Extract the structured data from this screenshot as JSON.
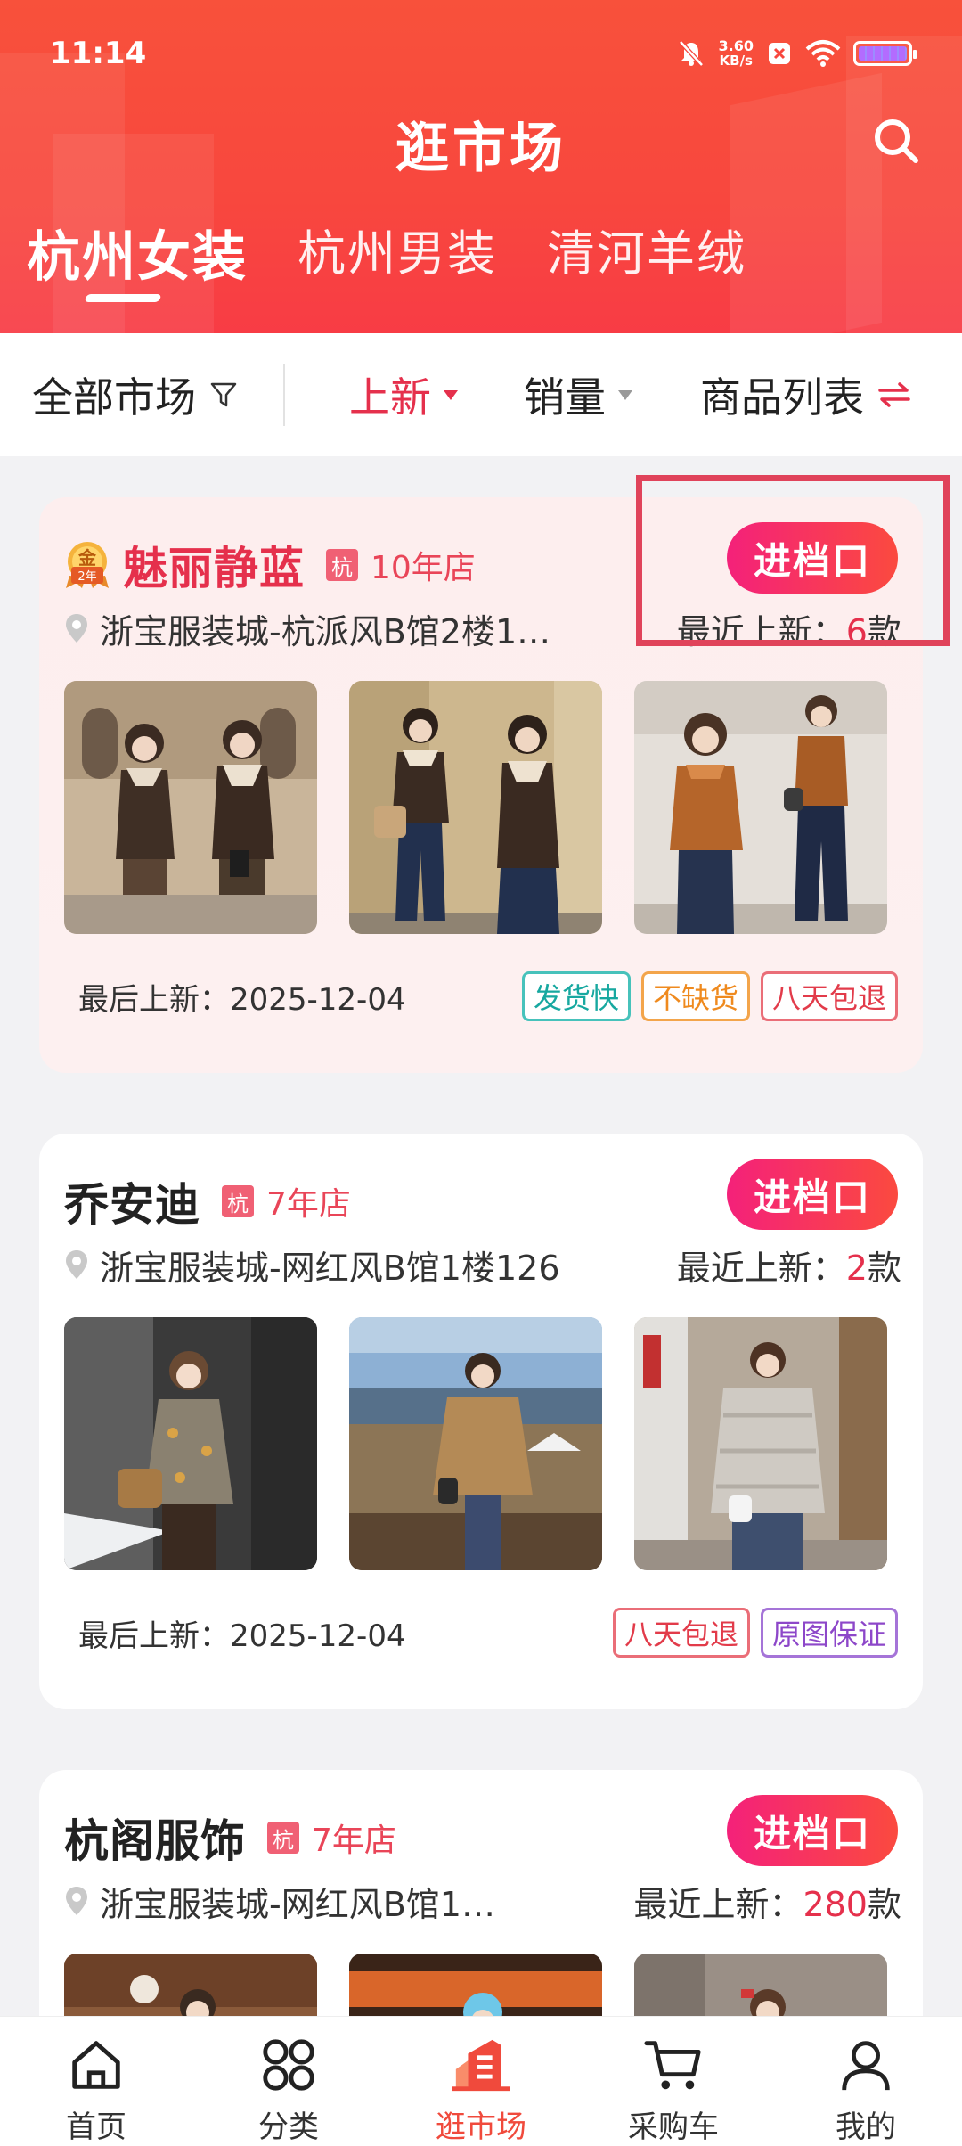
{
  "status_bar": {
    "time": "11:14",
    "net_speed": "3.60",
    "net_unit": "KB/s"
  },
  "header": {
    "title": "逛市场",
    "tabs": [
      {
        "label": "杭州女装",
        "active": true
      },
      {
        "label": "杭州男装",
        "active": false
      },
      {
        "label": "清河羊绒",
        "active": false
      }
    ]
  },
  "filters": {
    "all_markets": "全部市场",
    "new": "上新",
    "sales": "销量",
    "list": "商品列表"
  },
  "shops": [
    {
      "name": "魅丽静蓝",
      "region_badge": "杭",
      "age": "10年店",
      "medal": {
        "top": "金",
        "bottom": "2年"
      },
      "enter_label": "进档口",
      "address": "浙宝服装城-杭派风B馆2楼1…",
      "recent_prefix": "最近上新：",
      "recent_count": "6",
      "recent_suffix": "款",
      "last_new": "最后上新：2025-12-04",
      "tags": [
        "发货快",
        "不缺货",
        "八天包退"
      ]
    },
    {
      "name": "乔安迪",
      "region_badge": "杭",
      "age": "7年店",
      "enter_label": "进档口",
      "address": "浙宝服装城-网红风B馆1楼126",
      "recent_prefix": "最近上新：",
      "recent_count": "2",
      "recent_suffix": "款",
      "last_new": "最后上新：2025-12-04",
      "tags": [
        "八天包退",
        "原图保证"
      ]
    },
    {
      "name": "杭阁服饰",
      "region_badge": "杭",
      "age": "7年店",
      "enter_label": "进档口",
      "address": "浙宝服装城-网红风B馆1…",
      "recent_prefix": "最近上新：",
      "recent_count": "280",
      "recent_suffix": "款"
    }
  ],
  "bottom_nav": [
    {
      "label": "首页",
      "icon": "home-icon"
    },
    {
      "label": "分类",
      "icon": "category-icon"
    },
    {
      "label": "逛市场",
      "icon": "market-icon",
      "active": true
    },
    {
      "label": "采购车",
      "icon": "cart-icon"
    },
    {
      "label": "我的",
      "icon": "profile-icon"
    }
  ],
  "colors": {
    "header_red": "#f8473e",
    "accent_pink": "#f4217a",
    "accent_red": "#e5304c"
  }
}
